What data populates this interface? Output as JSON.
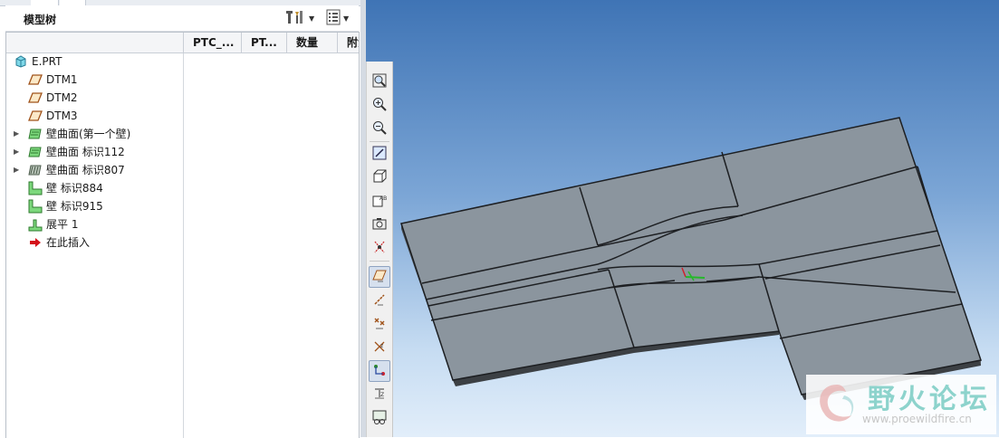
{
  "panel": {
    "title": "模型树",
    "columns": [
      "PTC_...",
      "PT...",
      "数量",
      "附注"
    ],
    "items": [
      {
        "label": "E.PRT",
        "icon": "part-icon",
        "expand": ""
      },
      {
        "label": "DTM1",
        "icon": "datum-plane-icon",
        "expand": ""
      },
      {
        "label": "DTM2",
        "icon": "datum-plane-icon",
        "expand": ""
      },
      {
        "label": "DTM3",
        "icon": "datum-plane-icon",
        "expand": ""
      },
      {
        "label": "壁曲面(第一个壁)",
        "icon": "wall-surface-icon",
        "expand": "▶"
      },
      {
        "label": "壁曲面 标识112",
        "icon": "wall-surface-icon",
        "expand": "▶"
      },
      {
        "label": "壁曲面 标识807",
        "icon": "wall-surface-icon",
        "expand": "▶"
      },
      {
        "label": "壁 标识884",
        "icon": "flat-wall-icon",
        "expand": ""
      },
      {
        "label": "壁 标识915",
        "icon": "flat-wall-icon",
        "expand": ""
      },
      {
        "label": "展平 1",
        "icon": "unbend-icon",
        "expand": ""
      },
      {
        "label": "在此插入",
        "icon": "insert-here-icon",
        "expand": ""
      }
    ]
  },
  "header_buttons": [
    "settings-icon",
    "show-icon"
  ],
  "toolbar": [
    "refit-icon",
    "zoom-in-icon",
    "zoom-out-icon",
    "repaint-icon",
    "view-orientation-icon",
    "saved-views-icon",
    "screenshot-icon",
    "display-style-icon",
    "datum-plane-display-icon",
    "datum-axis-display-icon",
    "point-display-icon",
    "csys-display-icon",
    "annotation-display-icon",
    "spin-center-icon",
    "appearance-icon"
  ],
  "toolbar_active": [
    8,
    12
  ],
  "watermark": {
    "title": "野火论坛",
    "url": "www.proewildfire.cn"
  },
  "colors": {
    "sheet_top": "#8b959e",
    "sheet_edge": "#4a4e52",
    "accent": "#3f74b5"
  }
}
